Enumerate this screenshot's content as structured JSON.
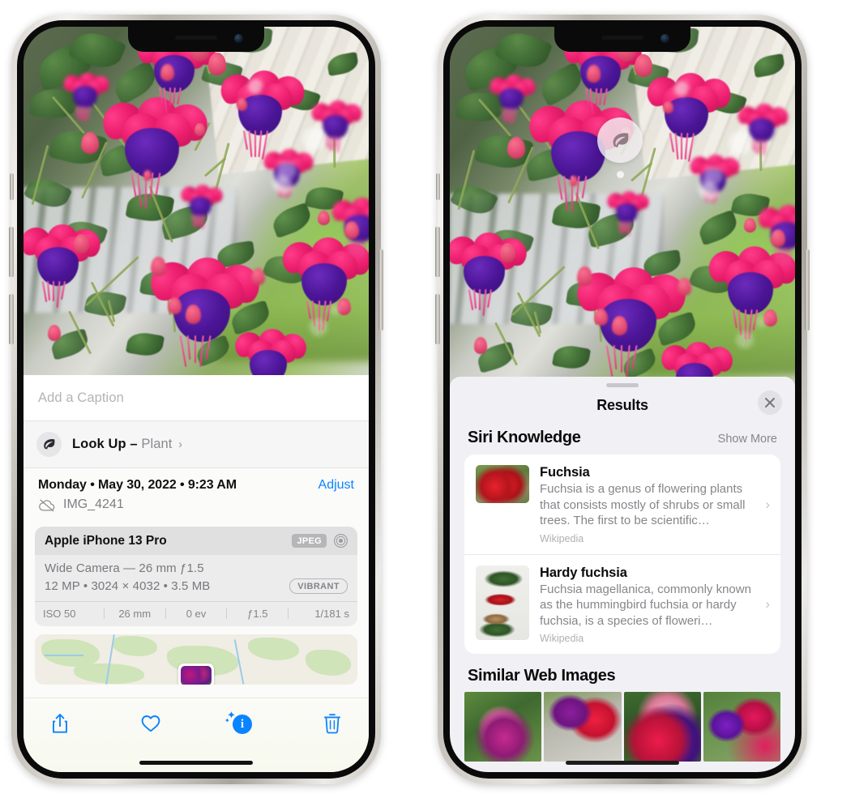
{
  "left_phone": {
    "caption": {
      "placeholder": "Add a Caption",
      "value": ""
    },
    "lookup_row": {
      "icon": "leaf-icon",
      "label": "Look Up –",
      "subject": "Plant",
      "chevron": "›"
    },
    "metadata": {
      "date_line": "Monday • May 30, 2022 • 9:23 AM",
      "adjust_label": "Adjust",
      "filename": "IMG_4241",
      "cloud_icon": "cloud-slash-icon"
    },
    "exif": {
      "device": "Apple iPhone 13 Pro",
      "format_badge": "JPEG",
      "aperture_icon": "aperture-icon",
      "lens_line": "Wide Camera — 26 mm ƒ1.5",
      "size_line": "12 MP • 3024 × 4032 • 3.5 MB",
      "style_badge": "VIBRANT",
      "stats": [
        "ISO 50",
        "26 mm",
        "0 ev",
        "ƒ1.5",
        "1/181 s"
      ]
    },
    "toolbar": [
      {
        "name": "share-button",
        "icon": "share-icon"
      },
      {
        "name": "favorite-button",
        "icon": "heart-icon"
      },
      {
        "name": "info-button",
        "icon": "info-sparkle-icon"
      },
      {
        "name": "delete-button",
        "icon": "trash-icon"
      }
    ]
  },
  "right_phone": {
    "visual_lookup_badge": {
      "icon": "leaf-icon"
    },
    "sheet": {
      "title": "Results",
      "close_icon": "close-icon",
      "siri_knowledge": {
        "title": "Siri Knowledge",
        "show_more": "Show More",
        "items": [
          {
            "name": "Fuchsia",
            "description": "Fuchsia is a genus of flowering plants that consists mostly of shrubs or small trees. The first to be scientific…",
            "source": "Wikipedia",
            "chevron": "›"
          },
          {
            "name": "Hardy fuchsia",
            "description": "Fuchsia magellanica, commonly known as the hummingbird fuchsia or hardy fuchsia, is a species of floweri…",
            "source": "Wikipedia",
            "chevron": "›"
          }
        ]
      },
      "similar_web_images": {
        "title": "Similar Web Images",
        "count": 4
      }
    }
  },
  "colors": {
    "accent_blue": "#0a84ff",
    "sheet_bg": "#f1f1f5",
    "card_bg": "#ffffff",
    "secondary_text": "#86868b"
  }
}
